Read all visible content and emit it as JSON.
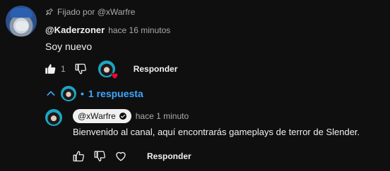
{
  "pinned": {
    "text": "Fijado por @xWarfre",
    "icon": "pin-icon"
  },
  "comment": {
    "author": "@Kaderzoner",
    "time": "hace 16 minutos",
    "text": "Soy nuevo",
    "like_count": "1",
    "reply_label": "Responder",
    "creator_hearted": true
  },
  "replies_toggle": {
    "label": "1 respuesta",
    "separator": "•"
  },
  "reply": {
    "author": "@xWarfre",
    "time": "hace 1 minuto",
    "text": "Bienvenido al canal, aquí encontrarás gameplays de terror de Slender.",
    "reply_label": "Responder",
    "verified": true
  },
  "colors": {
    "background": "#0f0f0f",
    "text": "#f1f1f1",
    "secondary_text": "#aaaaaa",
    "link_blue": "#3ea6ff",
    "heart_red": "#ff0033"
  }
}
